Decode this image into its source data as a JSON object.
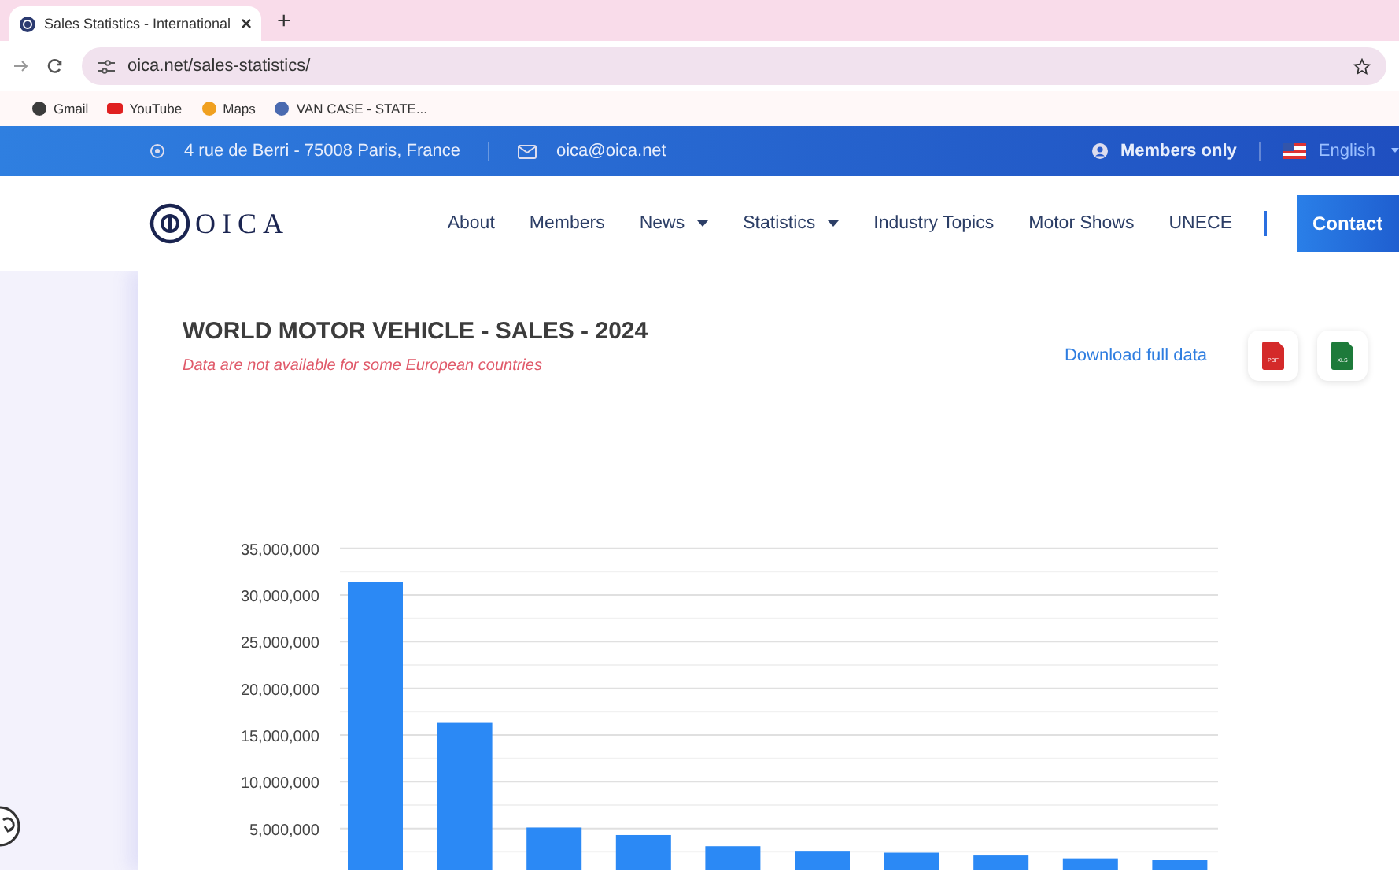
{
  "browser": {
    "tab_title": "Sales Statistics - International",
    "new_tab": "+",
    "close": "×",
    "url": "oica.net/sales-statistics/",
    "bookmarks": [
      {
        "label": "Gmail",
        "color": "#3c3c3c"
      },
      {
        "label": "YouTube",
        "color": "#e02020"
      },
      {
        "label": "Maps",
        "color": "#f0a020"
      },
      {
        "label": "VAN CASE - STATE...",
        "color": "#4a6ab0"
      }
    ]
  },
  "topbar": {
    "address": "4 rue de Berri - 75008 Paris, France",
    "email": "oica@oica.net",
    "members": "Members only",
    "language": "English"
  },
  "nav": {
    "logo": "OICA",
    "items": [
      {
        "label": "About",
        "dropdown": false
      },
      {
        "label": "Members",
        "dropdown": false
      },
      {
        "label": "News",
        "dropdown": true
      },
      {
        "label": "Statistics",
        "dropdown": true
      },
      {
        "label": "Industry Topics",
        "dropdown": false
      },
      {
        "label": "Motor Shows",
        "dropdown": false
      },
      {
        "label": "UNECE",
        "dropdown": false
      }
    ],
    "contact": "Contact"
  },
  "content": {
    "title": "WORLD MOTOR VEHICLE - SALES - 2024",
    "note": "Data are not available for some European countries",
    "download": "Download full data",
    "files": [
      {
        "kind": "pdf",
        "label": "PDF"
      },
      {
        "kind": "xls",
        "label": "XLS"
      }
    ],
    "chart_data": {
      "type": "bar",
      "grid": true,
      "values": [
        31400000,
        16300000,
        5100000,
        4300000,
        3100000,
        2600000,
        2400000,
        2100000,
        1800000,
        1600000
      ],
      "ylim": [
        0,
        35000000
      ],
      "yticks": [
        {
          "value": 5000000,
          "label": "5,000,000"
        },
        {
          "value": 10000000,
          "label": "10,000,000"
        },
        {
          "value": 15000000,
          "label": "15,000,000"
        },
        {
          "value": 20000000,
          "label": "20,000,000"
        },
        {
          "value": 25000000,
          "label": "25,000,000"
        },
        {
          "value": 30000000,
          "label": "30,000,000"
        },
        {
          "value": 35000000,
          "label": "35,000,000"
        }
      ]
    }
  }
}
